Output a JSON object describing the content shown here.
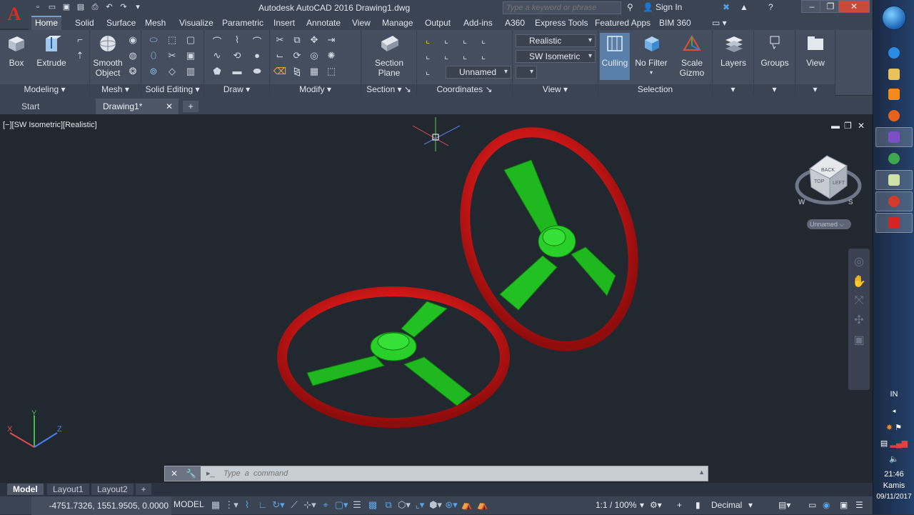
{
  "window": {
    "title": "Autodesk AutoCAD 2016    Drawing1.dwg",
    "search_placeholder": "Type a keyword or phrase",
    "sign_in": "Sign In"
  },
  "ribbon_tabs": [
    "Home",
    "Solid",
    "Surface",
    "Mesh",
    "Visualize",
    "Parametric",
    "Insert",
    "Annotate",
    "View",
    "Manage",
    "Output",
    "Add-ins",
    "A360",
    "Express Tools",
    "Featured Apps",
    "BIM 360"
  ],
  "ribbon": {
    "box": "Box",
    "extrude": "Extrude",
    "smooth_object": "Smooth Object",
    "section_plane": "Section Plane",
    "culling": "Culling",
    "no_filter": "No Filter",
    "scale_gizmo": "Scale Gizmo",
    "layers": "Layers",
    "groups": "Groups",
    "view": "View",
    "visual_style": "Realistic",
    "view_preset": "SW Isometric",
    "ucs_name": "Unnamed",
    "panels": {
      "modeling": "Modeling",
      "mesh": "Mesh",
      "solid_editing": "Solid Editing",
      "draw": "Draw",
      "modify": "Modify",
      "section": "Section",
      "coordinates": "Coordinates",
      "view": "View",
      "selection": "Selection"
    }
  },
  "doc_tabs": {
    "start": "Start",
    "drawing": "Drawing1*"
  },
  "viewport": {
    "label": "[−][SW Isometric][Realistic]",
    "viewcube_top": "TOP",
    "viewcube_back": "BACK",
    "viewcube_left": "LEFT",
    "compass_w": "W",
    "compass_s": "S",
    "wcs_label": "Unnamed",
    "axis_x": "X",
    "axis_y": "Y",
    "axis_z": "Z"
  },
  "command_line": {
    "placeholder": "Type  a  command"
  },
  "layout_tabs": [
    "Model",
    "Layout1",
    "Layout2"
  ],
  "status": {
    "coords": "-4751.7326, 1551.9505, 0.0000",
    "model": "MODEL",
    "scale": "1:1 / 100%",
    "units": "Decimal"
  },
  "taskbar": {
    "lang": "IN",
    "time": "21:46",
    "day": "Kamis",
    "date": "09/11/2017"
  },
  "colors": {
    "rim": "#d21a1a",
    "spokes": "#1fb81f",
    "viewport_bg": "#212830"
  }
}
